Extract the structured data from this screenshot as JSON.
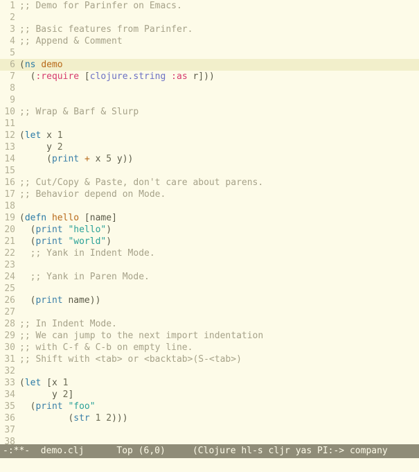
{
  "editor": {
    "highlighted_line": 6,
    "tokens": {
      "1": [
        [
          "c",
          ";; Demo for Parinfer on Emacs."
        ]
      ],
      "2": [],
      "3": [
        [
          "c",
          ";; Basic features from Parinfer."
        ]
      ],
      "4": [
        [
          "c",
          ";; Append & Comment"
        ]
      ],
      "5": [],
      "6": [
        [
          "p",
          "("
        ],
        [
          "kw",
          "ns"
        ],
        [
          "p",
          " "
        ],
        [
          "nm",
          "demo"
        ]
      ],
      "7": [
        [
          "p",
          "  ("
        ],
        [
          "ky",
          ":require"
        ],
        [
          "p",
          " ["
        ],
        [
          "sym",
          "clojure.string"
        ],
        [
          "p",
          " "
        ],
        [
          "ky",
          ":as"
        ],
        [
          "p",
          " r]))"
        ]
      ],
      "8": [],
      "9": [],
      "10": [
        [
          "c",
          ";; Wrap & Barf & Slurp"
        ]
      ],
      "11": [],
      "12": [
        [
          "p",
          "("
        ],
        [
          "kw",
          "let"
        ],
        [
          "p",
          " x "
        ],
        [
          "n",
          "1"
        ]
      ],
      "13": [
        [
          "p",
          "     y "
        ],
        [
          "n",
          "2"
        ]
      ],
      "14": [
        [
          "p",
          "     ("
        ],
        [
          "fn",
          "print"
        ],
        [
          "p",
          " "
        ],
        [
          "op",
          "+"
        ],
        [
          "p",
          " x "
        ],
        [
          "n",
          "5"
        ],
        [
          "p",
          " y))"
        ]
      ],
      "15": [],
      "16": [
        [
          "c",
          ";; Cut/Copy & Paste, don't care about parens."
        ]
      ],
      "17": [
        [
          "c",
          ";; Behavior depend on Mode."
        ]
      ],
      "18": [],
      "19": [
        [
          "p",
          "("
        ],
        [
          "kw",
          "defn"
        ],
        [
          "p",
          " "
        ],
        [
          "nm",
          "hello"
        ],
        [
          "p",
          " [name]"
        ]
      ],
      "20": [
        [
          "p",
          "  ("
        ],
        [
          "fn",
          "print"
        ],
        [
          "p",
          " "
        ],
        [
          "s",
          "\"hello\""
        ],
        [
          "p",
          ")"
        ]
      ],
      "21": [
        [
          "p",
          "  ("
        ],
        [
          "fn",
          "print"
        ],
        [
          "p",
          " "
        ],
        [
          "s",
          "\"world\""
        ],
        [
          "p",
          ")"
        ]
      ],
      "22": [
        [
          "p",
          "  "
        ],
        [
          "c",
          ";; Yank in Indent Mode."
        ]
      ],
      "23": [],
      "24": [
        [
          "p",
          "  "
        ],
        [
          "c",
          ";; Yank in Paren Mode."
        ]
      ],
      "25": [],
      "26": [
        [
          "p",
          "  ("
        ],
        [
          "fn",
          "print"
        ],
        [
          "p",
          " name))"
        ]
      ],
      "27": [],
      "28": [
        [
          "c",
          ";; In Indent Mode."
        ]
      ],
      "29": [
        [
          "c",
          ";; We can jump to the next import indentation"
        ]
      ],
      "30": [
        [
          "c",
          ";; with C-f & C-b on empty line."
        ]
      ],
      "31": [
        [
          "c",
          ";; Shift with <tab> or <backtab>(S-<tab>)"
        ]
      ],
      "32": [],
      "33": [
        [
          "p",
          "("
        ],
        [
          "kw",
          "let"
        ],
        [
          "p",
          " [x "
        ],
        [
          "n",
          "1"
        ]
      ],
      "34": [
        [
          "p",
          "      y "
        ],
        [
          "n",
          "2"
        ],
        [
          "p",
          "]"
        ]
      ],
      "35": [
        [
          "p",
          "  ("
        ],
        [
          "fn",
          "print"
        ],
        [
          "p",
          " "
        ],
        [
          "s",
          "\"foo\""
        ]
      ],
      "36": [
        [
          "p",
          "         ("
        ],
        [
          "fn",
          "str"
        ],
        [
          "p",
          " "
        ],
        [
          "n",
          "1"
        ],
        [
          "p",
          " "
        ],
        [
          "n",
          "2"
        ],
        [
          "p",
          ")))"
        ]
      ],
      "37": [],
      "38": []
    }
  },
  "modeline": {
    "status": "-:**-",
    "buffer": "demo.clj",
    "position": "Top (6,0)",
    "modes": "(Clojure hl-s cljr yas PI:-> company "
  }
}
